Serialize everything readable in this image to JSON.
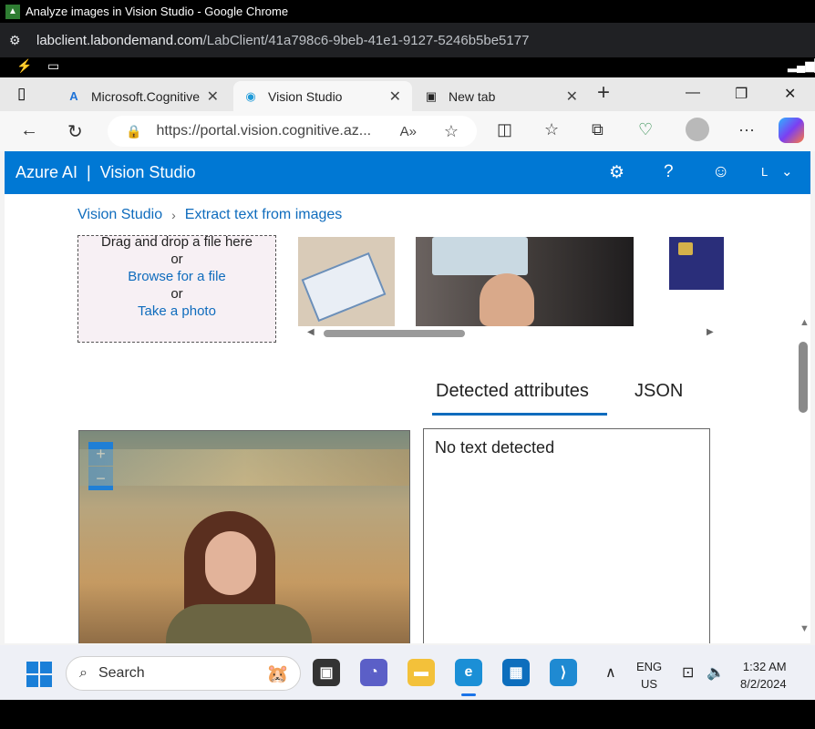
{
  "window": {
    "title": "Analyze images in Vision Studio - Google Chrome",
    "url_host": "labclient.labondemand.com",
    "url_path": "/LabClient/41a798c6-9beb-41e1-9127-5246b5be5177"
  },
  "edge": {
    "tabs": [
      {
        "label": "Microsoft.Cognitive"
      },
      {
        "label": "Vision Studio"
      },
      {
        "label": "New tab"
      }
    ],
    "address": "https://portal.vision.cognitive.az..."
  },
  "header": {
    "brand": "Azure AI",
    "product": "Vision Studio",
    "user_initial": "L"
  },
  "breadcrumb": {
    "root": "Vision Studio",
    "current": "Extract text from images"
  },
  "dropzone": {
    "line1": "Drag and drop a file here",
    "or1": "or",
    "browse": "Browse for a file",
    "or2": "or",
    "photo": "Take a photo"
  },
  "results": {
    "tab_attributes": "Detected attributes",
    "tab_json": "JSON",
    "message": "No text detected"
  },
  "zoom": {
    "in": "+",
    "out": "−"
  },
  "taskbar": {
    "search_placeholder": "Search",
    "lang": "ENG",
    "region": "US",
    "time": "1:32 AM",
    "date": "8/2/2024"
  },
  "colors": {
    "azure_blue": "#0078d4",
    "link": "#0f6cbd"
  }
}
